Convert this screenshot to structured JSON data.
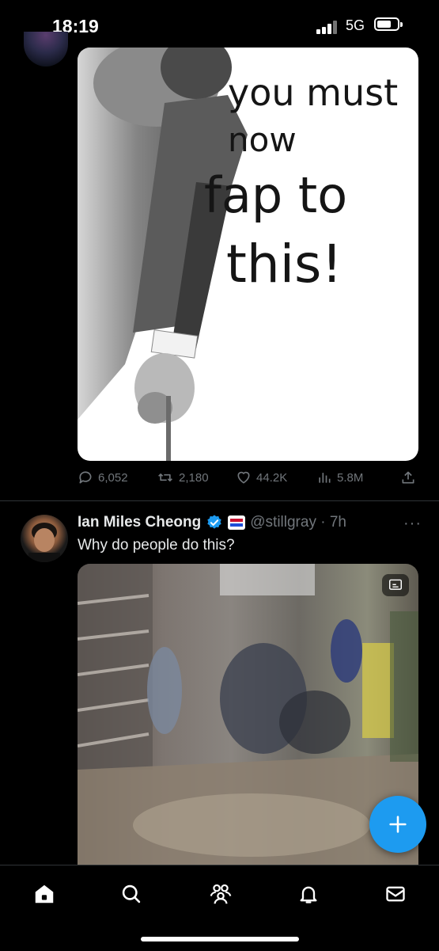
{
  "status_bar": {
    "time": "18:19",
    "network": "5G"
  },
  "tweet1": {
    "image_text": [
      "you must",
      "now",
      "fap to",
      "this!"
    ],
    "stats": {
      "replies": "6,052",
      "retweets": "2,180",
      "likes": "44.2K",
      "views": "5.8M"
    }
  },
  "tweet2": {
    "author_name": "Ian Miles Cheong",
    "handle_time": "@stillgray · 7h",
    "text": "Why do people do this?",
    "more": "···"
  },
  "colors": {
    "accent": "#1d9bf0",
    "muted": "#71767b",
    "divider": "#2f3336",
    "background": "#000000"
  },
  "icons": {
    "reply": "reply-icon",
    "retweet": "retweet-icon",
    "like": "heart-icon",
    "views": "bar-chart-icon",
    "share": "share-icon",
    "fab": "plus-icon",
    "nav": [
      "home-icon",
      "search-icon",
      "communities-icon",
      "bell-icon",
      "mail-icon"
    ]
  }
}
